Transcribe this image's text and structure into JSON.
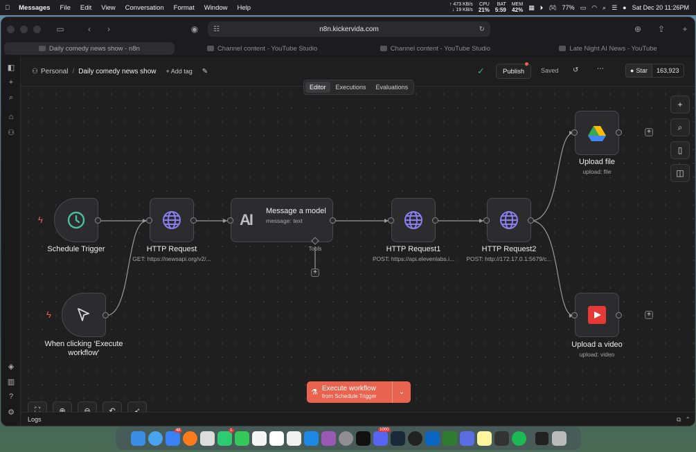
{
  "menubar": {
    "app": "Messages",
    "items": [
      "File",
      "Edit",
      "View",
      "Conversation",
      "Format",
      "Window",
      "Help"
    ],
    "net_up": "473 KB/s",
    "net_down": "19 KB/s",
    "cpu_label": "CPU",
    "cpu": "21%",
    "bat_label": "BAT",
    "bat": "5:59",
    "mem_label": "MEM",
    "mem": "42%",
    "battery": "77%",
    "datetime": "Sat Dec 20  11:26PM"
  },
  "browser": {
    "url": "n8n.kickervida.com",
    "tabs": [
      {
        "label": "Daily comedy news show - n8n",
        "active": true
      },
      {
        "label": "Channel content - YouTube Studio",
        "active": false
      },
      {
        "label": "Channel content - YouTube Studio",
        "active": false
      },
      {
        "label": "Late Night AI News - YouTube",
        "active": false
      }
    ]
  },
  "header": {
    "project": "Personal",
    "separator": "/",
    "workflow_name": "Daily comedy news show",
    "add_tag": "+ Add tag",
    "publish": "Publish",
    "saved": "Saved",
    "star": "Star",
    "star_count": "163,923"
  },
  "segments": [
    "Editor",
    "Executions",
    "Evaluations"
  ],
  "nodes": {
    "schedule": {
      "label": "Schedule Trigger"
    },
    "manual": {
      "label": "When clicking ‘Execute workflow’"
    },
    "http1": {
      "label": "HTTP Request",
      "sub": "GET: https://newsapi.org/v2/..."
    },
    "model": {
      "label": "Message a model",
      "sub": "message: text",
      "tools": "Tools"
    },
    "http2": {
      "label": "HTTP Request1",
      "sub": "POST: https://api.elevenlabs.i..."
    },
    "http3": {
      "label": "HTTP Request2",
      "sub": "POST: http://172.17.0.1:5679/c..."
    },
    "upload_file": {
      "label": "Upload file",
      "sub": "upload: file"
    },
    "upload_video": {
      "label": "Upload a video",
      "sub": "upload: video"
    }
  },
  "execute": {
    "title": "Execute workflow",
    "sub": "from Schedule Trigger"
  },
  "logs": "Logs",
  "dock_badges": {
    "mail": "48",
    "messages": "1",
    "discord": "1000"
  },
  "colors": {
    "accent": "#e9644f",
    "trigger_bolt": "#e9644f",
    "clock": "#4bbf9a",
    "globe": "#8b7ff0",
    "youtube": "#e53935"
  }
}
